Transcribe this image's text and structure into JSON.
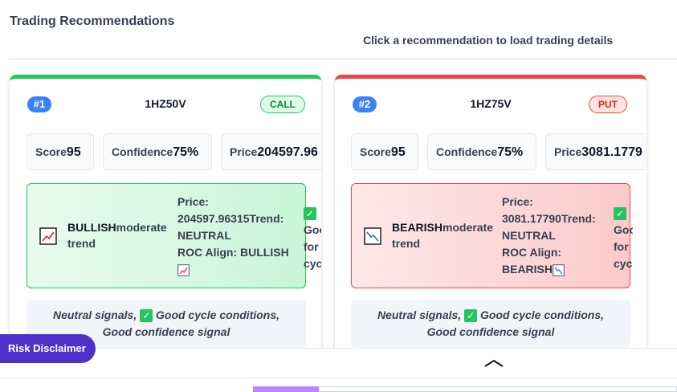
{
  "header": {
    "title": "Trading Recommendations",
    "hint": "Click a recommendation to load trading details"
  },
  "cards": [
    {
      "rank": "#1",
      "symbol": "1HZ50V",
      "action": "CALL",
      "stats": {
        "score_label": "Score",
        "score": "95",
        "confidence_label": "Confidence",
        "confidence": "75%",
        "price_label": "Price",
        "price": "204597.96"
      },
      "trend": {
        "direction": "BULLISH",
        "strength": "moderate trend",
        "price_line": "Price:",
        "price_value": "204597.96315",
        "trend_label": "Trend:",
        "trend_value": "NEUTRAL",
        "roc_label": "ROC Align:",
        "roc_value": "BULLISH",
        "cycles_text_1": "Goo",
        "cycles_text_2": "for",
        "cycles_text_3": "cyc"
      },
      "summary_1a": "Neutral signals,",
      "summary_1b": "Good cycle conditions,",
      "summary_2": "Good confidence signal",
      "icon": "chart-up-icon"
    },
    {
      "rank": "#2",
      "symbol": "1HZ75V",
      "action": "PUT",
      "stats": {
        "score_label": "Score",
        "score": "95",
        "confidence_label": "Confidence",
        "confidence": "75%",
        "price_label": "Price",
        "price": "3081.1779"
      },
      "trend": {
        "direction": "BEARISH",
        "strength": "moderate trend",
        "price_line": "Price:",
        "price_value": "3081.17790",
        "trend_label": "Trend:",
        "trend_value": "NEUTRAL",
        "roc_label": "ROC Align:",
        "roc_value": "BEARISH",
        "cycles_text_1": "Good",
        "cycles_text_2": "for",
        "cycles_text_3": "cycles"
      },
      "summary_1a": "Neutral signals,",
      "summary_1b": "Good cycle conditions,",
      "summary_2": "Good confidence signal",
      "icon": "chart-down-icon"
    }
  ],
  "footer": {
    "disclaimer": "Risk Disclaimer",
    "collapse_icon": "chevron-up-icon"
  },
  "colors": {
    "bull": "#22c55e",
    "bear": "#ef4444",
    "rank": "#3b82f6",
    "disclaimer": "#4f31c9"
  }
}
